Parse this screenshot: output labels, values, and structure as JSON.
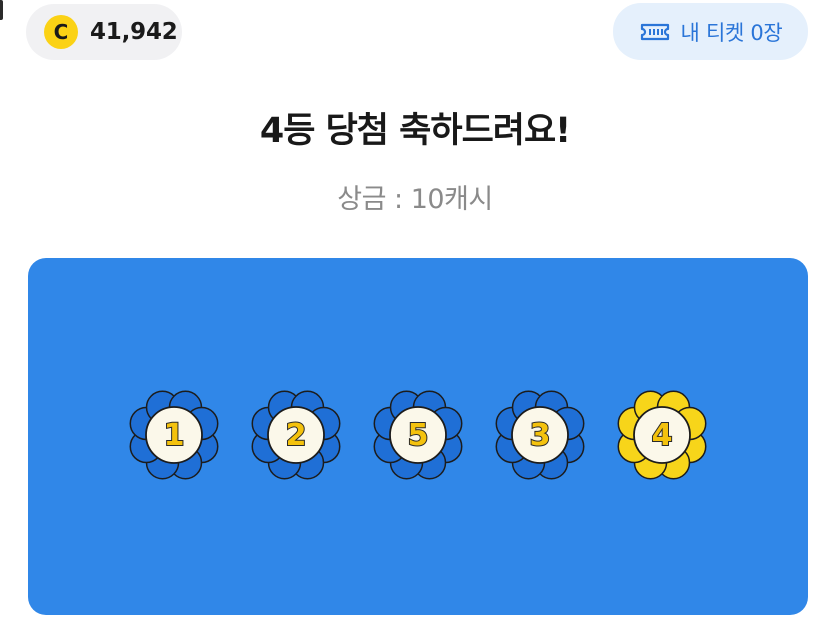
{
  "header": {
    "coin": {
      "icon": "coin-icon",
      "symbol": "C",
      "balance": "41,942",
      "color": "#fbd215"
    },
    "tickets": {
      "icon": "ticket-icon",
      "label": "내 티켓 0장",
      "color": "#2a75d8"
    }
  },
  "result": {
    "title": "4등 당첨 축하드려요!",
    "prize": "상금 : 10캐시"
  },
  "board": {
    "color": "#3087e8",
    "balls": [
      {
        "number": "1",
        "matched": false
      },
      {
        "number": "2",
        "matched": false
      },
      {
        "number": "5",
        "matched": false
      },
      {
        "number": "3",
        "matched": false
      },
      {
        "number": "4",
        "matched": true
      }
    ],
    "colors": {
      "flower_unmatched": "#1f6fd6",
      "flower_matched": "#f7d51a",
      "number": "#f4c20d"
    }
  }
}
